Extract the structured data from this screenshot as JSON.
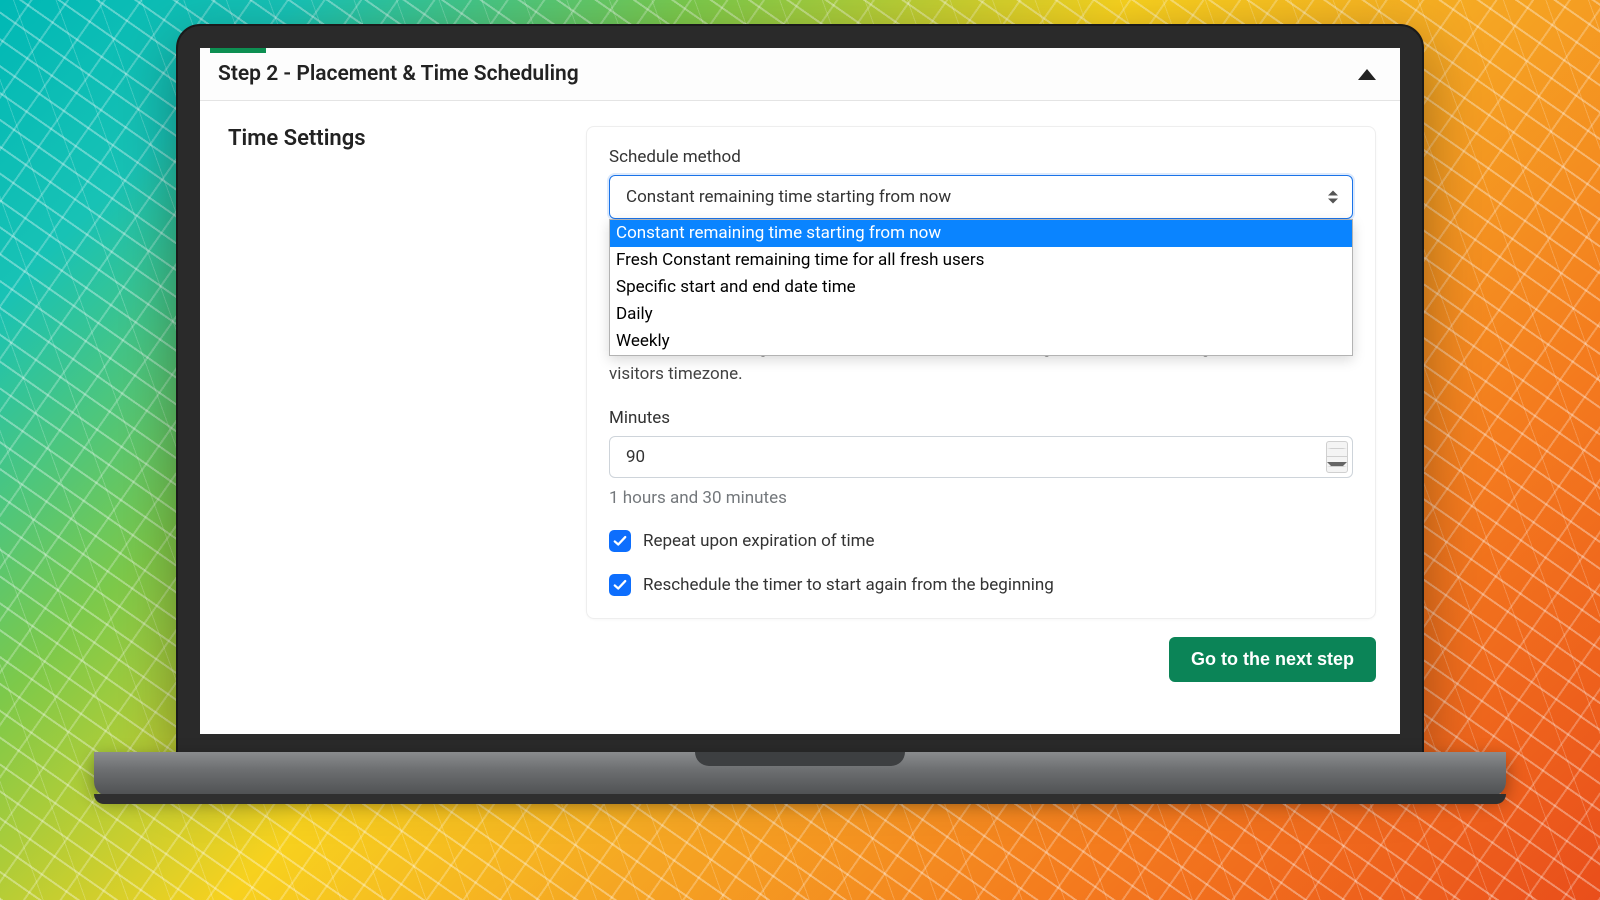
{
  "header": {
    "title": "Step 2 - Placement & Time Scheduling"
  },
  "section_title": "Time Settings",
  "schedule": {
    "label": "Schedule method",
    "selected": "Constant remaining time starting from now",
    "options": [
      "Constant remaining time starting from now",
      "Fresh Constant remaining time for all fresh users",
      "Specific start and end date time",
      "Daily",
      "Weekly"
    ]
  },
  "description": "consistent remaining time which means that the remaining time does not change based on the visitors timezone.",
  "minutes": {
    "label": "Minutes",
    "value": "90",
    "hint": "1 hours and 30 minutes"
  },
  "checks": {
    "repeat": "Repeat upon expiration of time",
    "reschedule": "Reschedule the timer to start again from the beginning"
  },
  "next_button": "Go to the next step"
}
